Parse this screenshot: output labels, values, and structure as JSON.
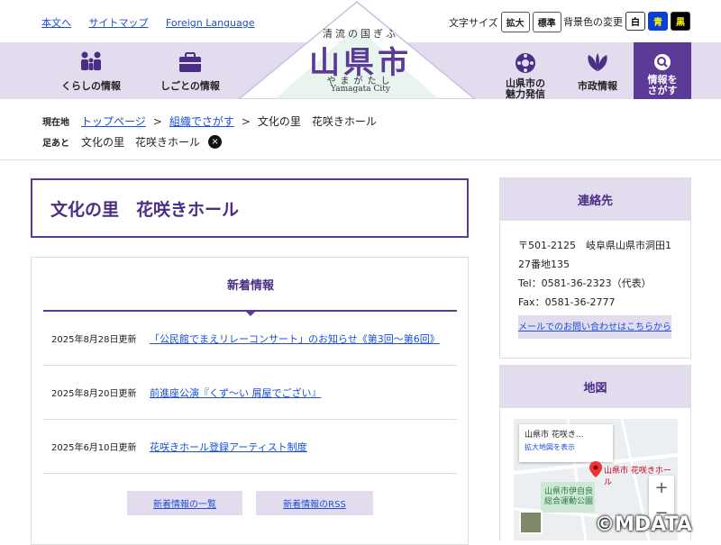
{
  "top_links": [
    "本文へ",
    "サイトマップ",
    "Foreign Language"
  ],
  "font_size": {
    "label": "文字サイズ",
    "large": "拡大",
    "standard": "標準"
  },
  "bg_color": {
    "label": "背景色の変更",
    "white": "白",
    "blue": "青",
    "black": "黒"
  },
  "logo": {
    "sub": "清流の国ぎふ",
    "main": "山県市",
    "kana": "やまがたし",
    "en": "Yamagata City"
  },
  "nav": {
    "living": "くらしの情報",
    "work": "しごとの情報",
    "charm_1": "山県市の",
    "charm_2": "魅力発信",
    "admin": "市政情報",
    "search_1": "情報を",
    "search_2": "さがす"
  },
  "breadcrumb": {
    "label": "現在地",
    "items": [
      "トップページ",
      "組織でさがす",
      "文化の里　花咲きホール"
    ]
  },
  "footprint": {
    "label": "足あと",
    "item": "文化の里　花咲きホール",
    "close": "×"
  },
  "page_title": "文化の里　花咲きホール",
  "news": {
    "title": "新着情報",
    "items": [
      {
        "date": "2025年8月28日更新",
        "title": "「公民館でまえリレーコンサート」のお知らせ《第3回～第6回》"
      },
      {
        "date": "2025年8月20日更新",
        "title": "前進座公演『くず～い 屑屋でござい』"
      },
      {
        "date": "2025年6月10日更新",
        "title": "花咲きホール登録アーティスト制度"
      }
    ],
    "list_button": "新着情報の一覧",
    "rss_button": "新着情報のRSS"
  },
  "contact": {
    "title": "連絡先",
    "address_1": "〒501-2125　岐阜県山県市洞田1",
    "address_2": "27番地135",
    "tel": "Tel：0581-36-2323（代表）",
    "fax": "Fax：0581-36-2777",
    "mail_button": "メールでのお問い合わせはこちらから"
  },
  "map": {
    "title": "地図",
    "card_title": "山県市 花咲き...",
    "card_link": "拡大地図を表示",
    "pin_label": "山県市 花咲きホール",
    "place_1": "山県市伊自良",
    "place_2": "総合運動公園",
    "zoom_in": "+",
    "zoom_out": "−"
  },
  "watermark": "©MDATA",
  "colors": {
    "accent": "#5b3b96",
    "band": "#e3dcef",
    "link": "#1a4fd6"
  }
}
